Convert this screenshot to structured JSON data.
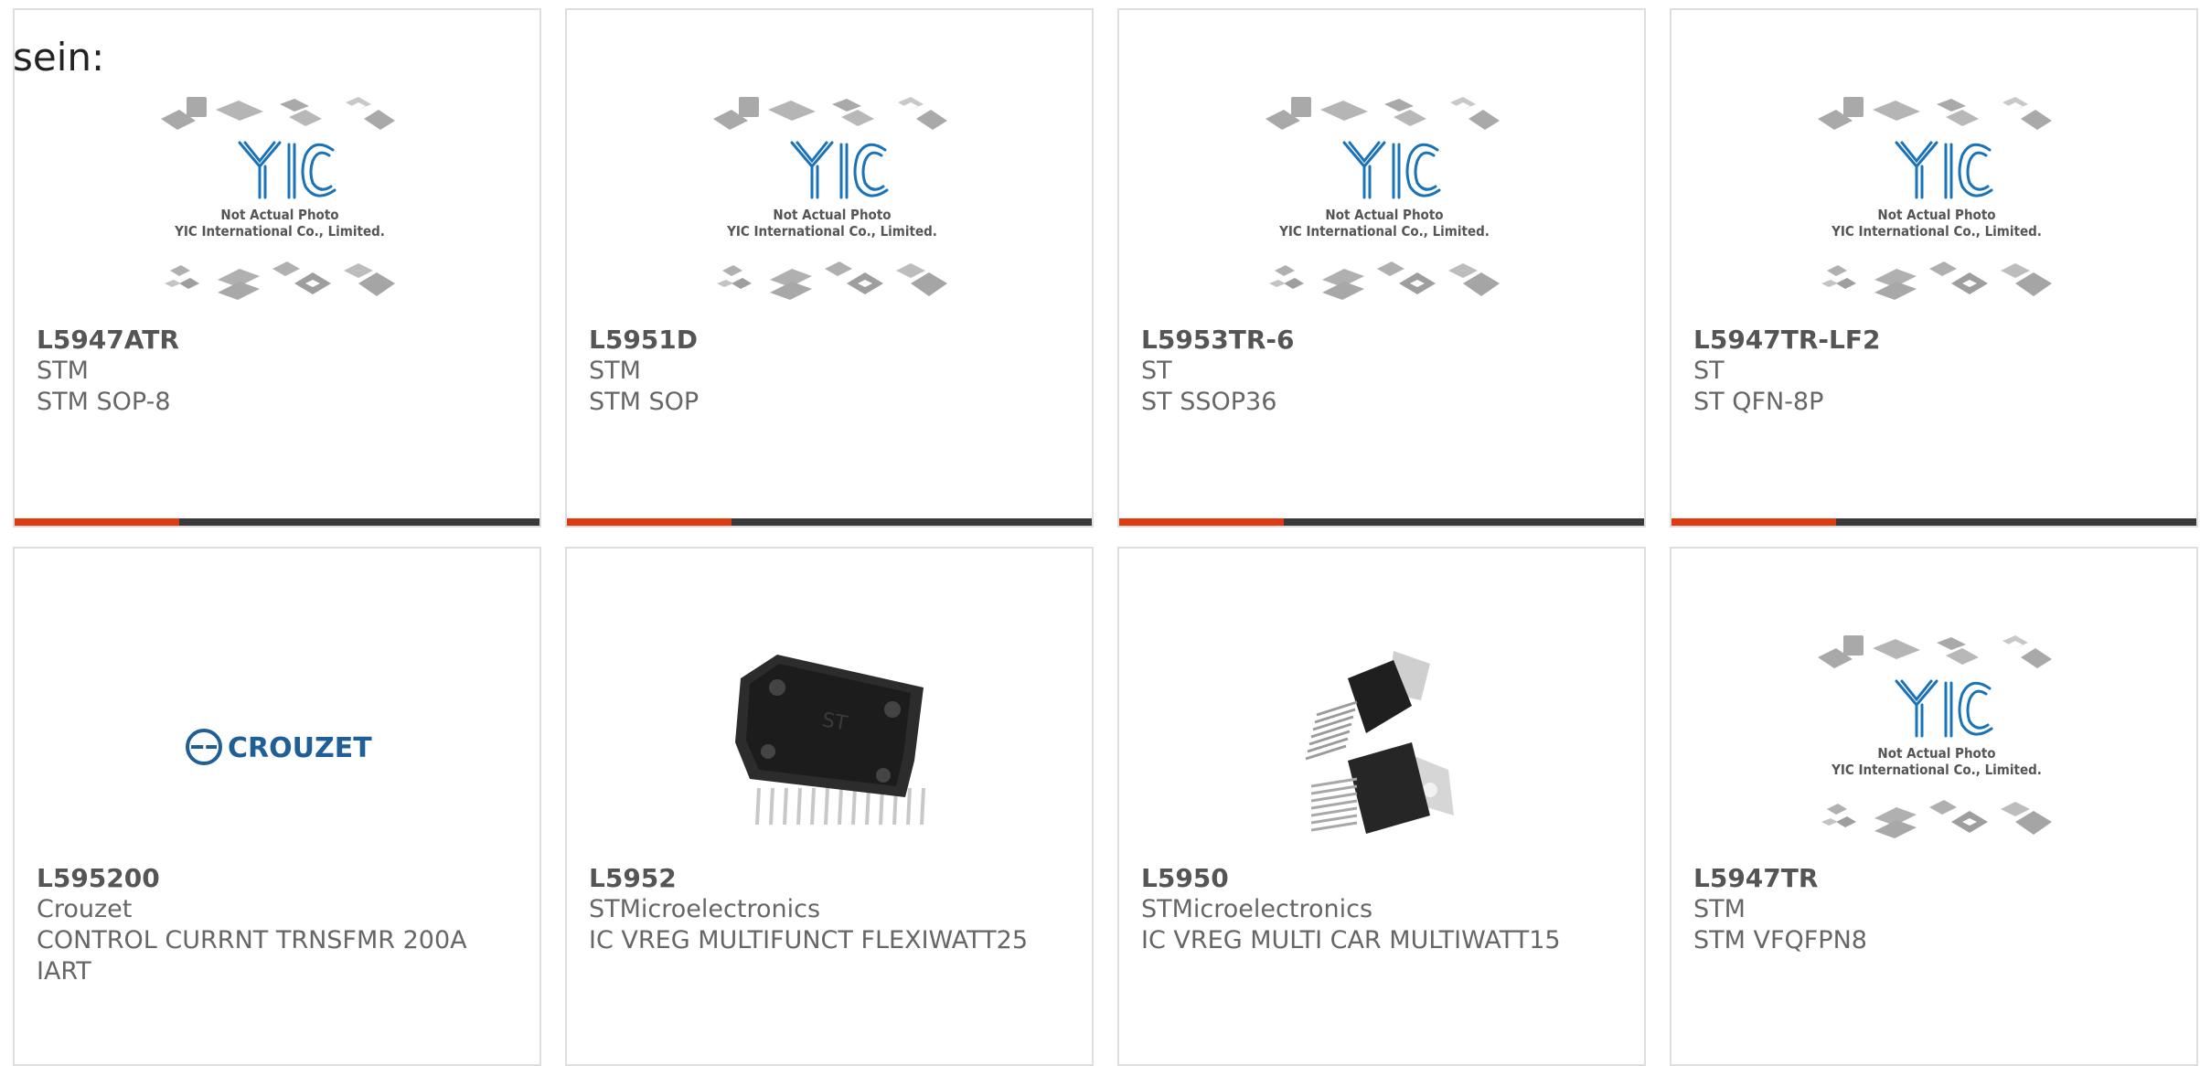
{
  "intro_text": "sein:",
  "placeholder": {
    "logo": "YIC",
    "line1": "Not Actual Photo",
    "line2": "YIC International Co., Limited."
  },
  "crouzet_logo_text": "CROUZET",
  "products": [
    {
      "part": "L5947ATR",
      "manufacturer": "STM",
      "description": "STM SOP-8",
      "image": "yic-placeholder"
    },
    {
      "part": "L5951D",
      "manufacturer": "STM",
      "description": "STM SOP",
      "image": "yic-placeholder"
    },
    {
      "part": "L5953TR-6",
      "manufacturer": "ST",
      "description": "ST SSOP36",
      "image": "yic-placeholder"
    },
    {
      "part": "L5947TR-LF2",
      "manufacturer": "ST",
      "description": "ST QFN-8P",
      "image": "yic-placeholder"
    },
    {
      "part": "L595200",
      "manufacturer": "Crouzet",
      "description": "CONTROL CURRNT TRNSFMR 200A IART",
      "image": "crouzet-logo"
    },
    {
      "part": "L5952",
      "manufacturer": "STMicroelectronics",
      "description": "IC VREG MULTIFUNCT FLEXIWATT25",
      "image": "flexiwatt-chip"
    },
    {
      "part": "L5950",
      "manufacturer": "STMicroelectronics",
      "description": "IC VREG MULTI CAR MULTIWATT15",
      "image": "multiwatt-chip"
    },
    {
      "part": "L5947TR",
      "manufacturer": "STM",
      "description": "STM VFQFPN8",
      "image": "yic-placeholder"
    }
  ],
  "colors": {
    "accent": "#e03a10",
    "bar": "#3a3a3a",
    "card_border": "#dedede",
    "yic_blue": "#1a73b8",
    "crouzet_blue": "#1d5f96"
  }
}
